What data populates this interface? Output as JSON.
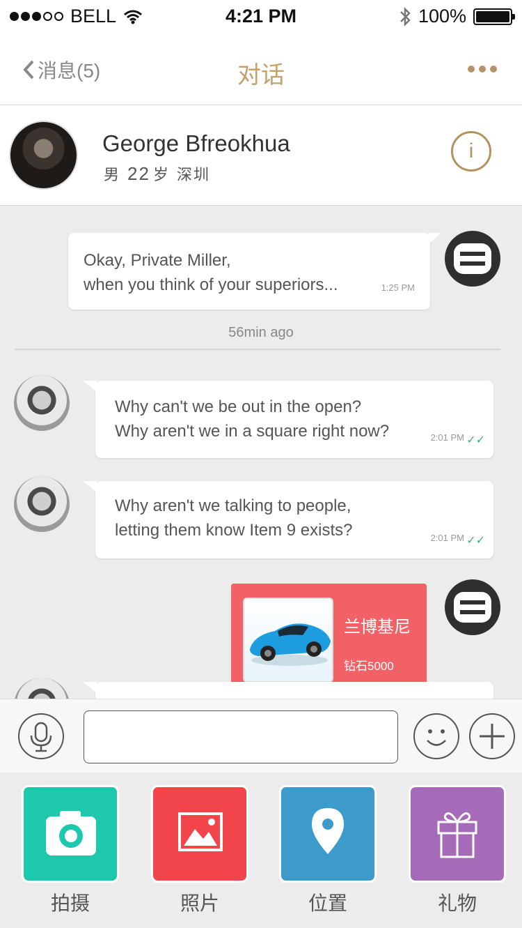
{
  "status_bar": {
    "carrier": "BELL",
    "time": "4:21 PM",
    "battery": "100%",
    "battery_level": 1.0
  },
  "nav": {
    "back_label": "消息(5)",
    "title": "对话"
  },
  "profile": {
    "name": "George Bfreokhua",
    "gender": "男",
    "age": "22",
    "age_unit": "岁",
    "city": "深圳",
    "info_label": "i"
  },
  "messages": [
    {
      "lines": [
        "Okay, Private Miller,",
        "when you think of your superiors..."
      ],
      "time": "1:25 PM"
    },
    {
      "lines": [
        "Why can't we be out in the open?",
        "Why aren't we in a square right now?"
      ],
      "time": "2:01 PM"
    },
    {
      "lines": [
        "Why aren't we talking to people,",
        "letting them know Item 9 exists?"
      ],
      "time": "2:01 PM"
    }
  ],
  "divider": "56min ago",
  "gift": {
    "name": "兰博基尼",
    "price": "钻石5000"
  },
  "input": {
    "placeholder": ""
  },
  "actions": [
    {
      "label": "拍摄",
      "color": "#1dc8ad"
    },
    {
      "label": "照片",
      "color": "#f2444b"
    },
    {
      "label": "位置",
      "color": "#3d9bcc"
    },
    {
      "label": "礼物",
      "color": "#a56bb9"
    }
  ],
  "colors": {
    "accent": "#c7a06a",
    "text_dark": "#333333",
    "read_check": "#3bb46a"
  }
}
